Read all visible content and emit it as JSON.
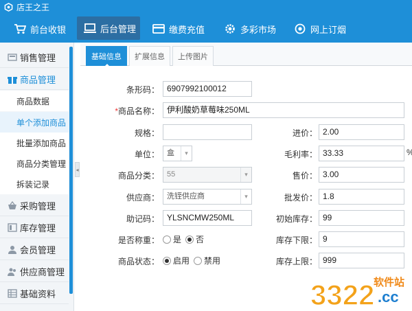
{
  "window": {
    "title": "店王之王"
  },
  "nav": [
    {
      "label": "前台收银",
      "icon": "cart-icon"
    },
    {
      "label": "后台管理",
      "icon": "monitor-icon",
      "active": true
    },
    {
      "label": "缴费充值",
      "icon": "card-icon"
    },
    {
      "label": "多彩市场",
      "icon": "gear-icon"
    },
    {
      "label": "网上订烟",
      "icon": "target-icon"
    }
  ],
  "sidebar": {
    "groups": [
      {
        "label": "销售管理",
        "icon": "register-icon"
      },
      {
        "label": "商品管理",
        "icon": "gift-icon",
        "open": true
      },
      {
        "label": "采购管理",
        "icon": "basket-icon"
      },
      {
        "label": "库存管理",
        "icon": "stock-icon"
      },
      {
        "label": "会员管理",
        "icon": "person-icon"
      },
      {
        "label": "供应商管理",
        "icon": "people-icon"
      },
      {
        "label": "基础资料",
        "icon": "table-icon"
      }
    ],
    "sub_items": [
      {
        "label": "商品数据"
      },
      {
        "label": "单个添加商品",
        "active": true
      },
      {
        "label": "批量添加商品"
      },
      {
        "label": "商品分类管理"
      },
      {
        "label": "拆装记录"
      }
    ]
  },
  "tabs": [
    {
      "label": "基础信息",
      "active": true
    },
    {
      "label": "扩展信息"
    },
    {
      "label": "上传图片"
    }
  ],
  "form": {
    "barcode": {
      "label": "条形码：",
      "value": "6907992100012"
    },
    "name": {
      "required": "*",
      "label": "商品名称：",
      "value": "伊利酸奶草莓味250ML"
    },
    "spec": {
      "label": "规格：",
      "value": ""
    },
    "cost_price": {
      "label": "进价：",
      "value": "2.00"
    },
    "unit": {
      "label": "单位：",
      "value": "盒"
    },
    "margin": {
      "label": "毛利率：",
      "value": "33.33",
      "suffix": "%"
    },
    "category": {
      "label": "商品分类：",
      "value": "55"
    },
    "sale_price": {
      "label": "售价：",
      "value": "3.00"
    },
    "supplier": {
      "label": "供应商：",
      "value": "洗铚供应商"
    },
    "wholesale_price": {
      "label": "批发价：",
      "value": "1.8"
    },
    "mnemonic": {
      "label": "助记码：",
      "value": "YLSNCMW250ML"
    },
    "initial_stock": {
      "label": "初始库存：",
      "value": "99"
    },
    "weighed": {
      "label": "是否称重：",
      "options": [
        "是",
        "否"
      ],
      "selected": "否"
    },
    "stock_min": {
      "label": "库存下限：",
      "value": "9"
    },
    "status": {
      "label": "商品状态：",
      "options": [
        "启用",
        "禁用"
      ],
      "selected": "启用"
    },
    "stock_max": {
      "label": "库存上限：",
      "value": "999"
    }
  },
  "watermark": {
    "text_a": "3322",
    "text_b": "软件站",
    "text_c": ".cc"
  },
  "colors": {
    "primary": "#1e8fd8",
    "nav_active": "#2c6ea3",
    "sidebar_bg": "#f2f5f8",
    "required": "#ee3333"
  }
}
